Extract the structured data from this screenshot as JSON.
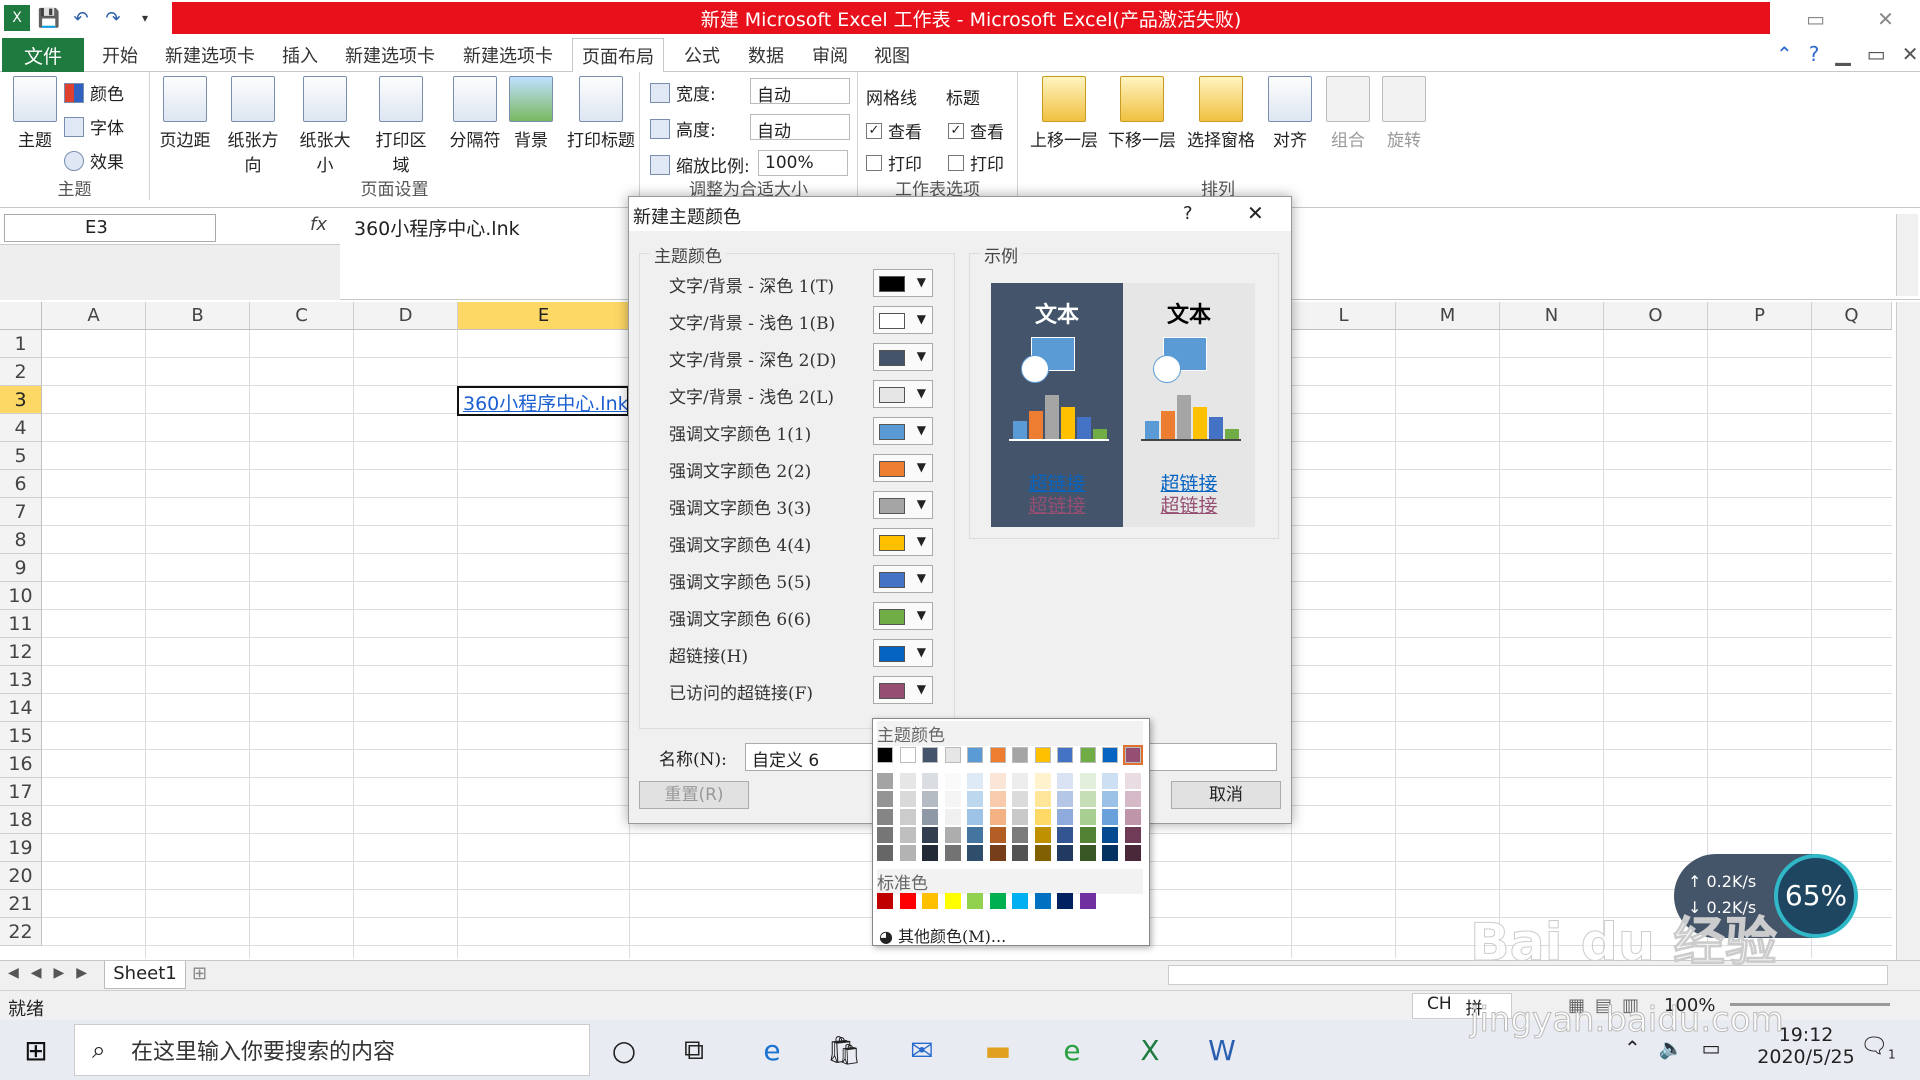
{
  "window": {
    "title": "新建 Microsoft Excel 工作表 - Microsoft Excel(产品激活失败)",
    "controls": [
      "▭",
      "✕"
    ]
  },
  "tabs": [
    "文件",
    "开始",
    "新建选项卡",
    "插入",
    "新建选项卡",
    "新建选项卡",
    "页面布局",
    "公式",
    "数据",
    "审阅",
    "视图"
  ],
  "active_tab": "页面布局",
  "ribbon": {
    "theme_group": {
      "label": "主题",
      "theme_btn": "主题",
      "colors": "颜色",
      "fonts": "字体",
      "effects": "效果"
    },
    "page_setup": {
      "label": "页面设置",
      "buttons": [
        "页边距",
        "纸张方向",
        "纸张大小",
        "打印区域",
        "分隔符",
        "背景",
        "打印标题"
      ]
    },
    "scale": {
      "label": "调整为合适大小",
      "width_label": "宽度:",
      "width_value": "自动",
      "height_label": "高度:",
      "height_value": "自动",
      "scale_label": "缩放比例:",
      "scale_value": "100%"
    },
    "sheet_options": {
      "label": "工作表选项",
      "gridlines": "网格线",
      "headings": "标题",
      "view": "查看",
      "print": "打印"
    },
    "arrange": {
      "label": "排列",
      "buttons": [
        "上移一层",
        "下移一层",
        "选择窗格",
        "对齐",
        "组合",
        "旋转"
      ]
    }
  },
  "formula_bar": {
    "name_box": "E3",
    "fx": "fx",
    "content": "360小程序中心.lnk"
  },
  "grid": {
    "columns": [
      "A",
      "B",
      "C",
      "D",
      "E",
      "L",
      "M",
      "N",
      "O",
      "P",
      "Q"
    ],
    "rows": [
      "1",
      "2",
      "3",
      "4",
      "5",
      "6",
      "7",
      "8",
      "9",
      "10",
      "11",
      "12",
      "13",
      "14",
      "15",
      "16",
      "17",
      "18",
      "19",
      "20",
      "21",
      "22"
    ],
    "selected_cell_text": "360小程序中心.lnk"
  },
  "sheet_tab": "Sheet1",
  "status": {
    "ready": "就绪",
    "ime1": "CH",
    "ime2": "拼",
    "zoom": "100%"
  },
  "taskbar": {
    "search_placeholder": "在这里输入你要搜索的内容",
    "time": "19:12",
    "date": "2020/5/25",
    "notif_count": "1"
  },
  "dialog": {
    "title": "新建主题颜色",
    "help": "?",
    "close": "✕",
    "theme_colors_legend": "主题颜色",
    "sample_legend": "示例",
    "rows": [
      {
        "label": "文字/背景 - 深色 1(T)",
        "color": "#000000"
      },
      {
        "label": "文字/背景 - 浅色 1(B)",
        "color": "#ffffff"
      },
      {
        "label": "文字/背景 - 深色 2(D)",
        "color": "#44546a"
      },
      {
        "label": "文字/背景 - 浅色 2(L)",
        "color": "#e7e6e6"
      },
      {
        "label": "强调文字颜色 1(1)",
        "color": "#5b9bd5"
      },
      {
        "label": "强调文字颜色 2(2)",
        "color": "#ed7d31"
      },
      {
        "label": "强调文字颜色 3(3)",
        "color": "#a5a5a5"
      },
      {
        "label": "强调文字颜色 4(4)",
        "color": "#ffc000"
      },
      {
        "label": "强调文字颜色 5(5)",
        "color": "#4472c4"
      },
      {
        "label": "强调文字颜色 6(6)",
        "color": "#70ad47"
      },
      {
        "label": "超链接(H)",
        "color": "#0563c1"
      },
      {
        "label": "已访问的超链接(F)",
        "color": "#954f72"
      }
    ],
    "sample_text": "文本",
    "sample_link": "超链接",
    "name_label": "名称(N):",
    "name_value": "自定义 6",
    "reset": "重置(R)",
    "cancel": "取消"
  },
  "palette": {
    "theme_label": "主题颜色",
    "standard_label": "标准色",
    "more": "其他颜色(M)...",
    "theme_row": [
      "#000000",
      "#ffffff",
      "#44546a",
      "#e7e6e6",
      "#5b9bd5",
      "#ed7d31",
      "#a5a5a5",
      "#ffc000",
      "#4472c4",
      "#70ad47",
      "#0563c1",
      "#954f72"
    ],
    "standard_row": [
      "#c00000",
      "#ff0000",
      "#ffc000",
      "#ffff00",
      "#92d050",
      "#00b050",
      "#00b0f0",
      "#0070c0",
      "#002060",
      "#7030a0"
    ]
  },
  "net_widget": {
    "up": "0.2K/s",
    "down": "0.2K/s",
    "percent": "65%"
  },
  "watermark": "Bai du 经验",
  "watermark_url": "jingyan.baidu.com"
}
